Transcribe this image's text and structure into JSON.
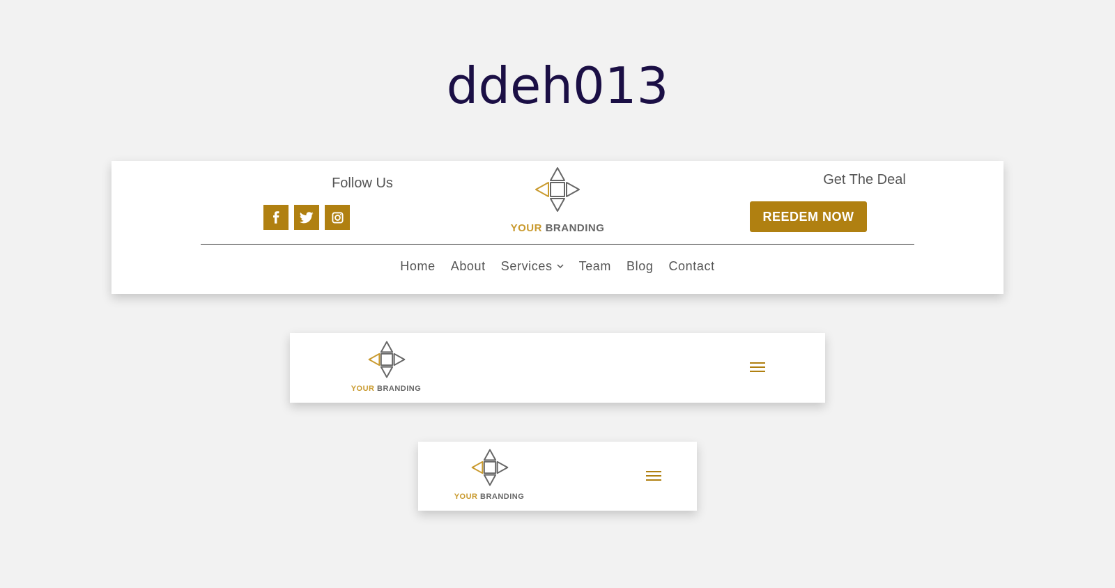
{
  "page": {
    "title": "ddeh013"
  },
  "colors": {
    "background": "#f2f2f2",
    "title": "#1b0f45",
    "accent": "#b08011",
    "logo_accent": "#c99a2e",
    "logo_gray": "#666666",
    "text": "#555555"
  },
  "desktop_header": {
    "follow_label": "Follow Us",
    "social_icons": [
      "facebook-icon",
      "twitter-icon",
      "instagram-icon"
    ],
    "logo": {
      "word_accent": "YOUR",
      "word_main": "BRANDING"
    },
    "deal_title": "Get The Deal",
    "deal_button": "REEDEM NOW",
    "nav": {
      "items": [
        {
          "label": "Home"
        },
        {
          "label": "About"
        },
        {
          "label": "Services",
          "has_dropdown": true
        },
        {
          "label": "Team"
        },
        {
          "label": "Blog"
        },
        {
          "label": "Contact"
        }
      ]
    }
  },
  "tablet_header": {
    "logo": {
      "word_accent": "YOUR",
      "word_main": "BRANDING"
    },
    "menu_icon": "hamburger-menu-icon"
  },
  "mobile_header": {
    "logo": {
      "word_accent": "YOUR",
      "word_main": "BRANDING"
    },
    "menu_icon": "hamburger-menu-icon"
  }
}
